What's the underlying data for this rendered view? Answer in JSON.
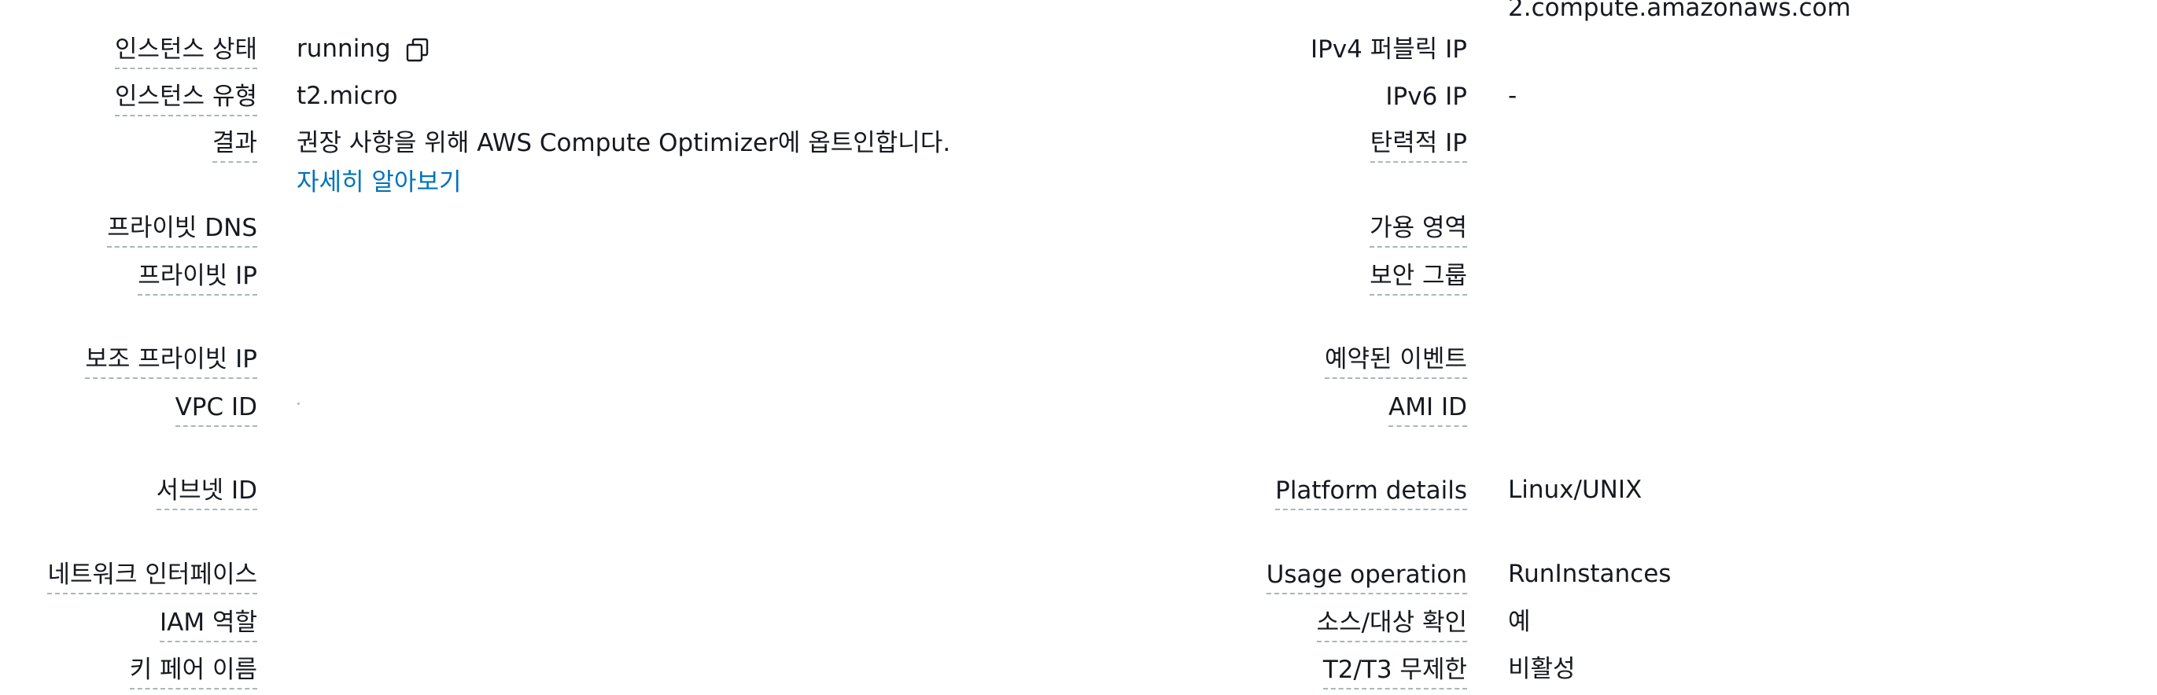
{
  "left": {
    "instance_state": {
      "label": "인스턴스 상태",
      "value": "running"
    },
    "instance_type": {
      "label": "인스턴스 유형",
      "value": "t2.micro"
    },
    "finding": {
      "label": "결과",
      "value": "권장 사항을 위해 AWS Compute Optimizer에 옵트인합니다.",
      "link": "자세히 알아보기"
    },
    "private_dns": {
      "label": "프라이빗 DNS"
    },
    "private_ip": {
      "label": "프라이빗 IP"
    },
    "secondary_private_ip": {
      "label": "보조 프라이빗 IP"
    },
    "vpc_id": {
      "label": "VPC ID"
    },
    "subnet_id": {
      "label": "서브넷 ID"
    },
    "network_interfaces": {
      "label": "네트워크 인터페이스"
    },
    "iam_role": {
      "label": "IAM 역할"
    },
    "key_pair": {
      "label": "키 페어 이름"
    }
  },
  "right": {
    "top_partial_value": "2.compute.amazonaws.com",
    "ipv4_public": {
      "label": "IPv4 퍼블릭 IP"
    },
    "ipv6": {
      "label": "IPv6 IP",
      "value": "-"
    },
    "elastic_ip": {
      "label": "탄력적 IP"
    },
    "availability_zone": {
      "label": "가용 영역"
    },
    "security_groups": {
      "label": "보안 그룹"
    },
    "scheduled_events": {
      "label": "예약된 이벤트"
    },
    "ami_id": {
      "label": "AMI ID"
    },
    "platform_details": {
      "label": "Platform details",
      "value": "Linux/UNIX"
    },
    "usage_operation": {
      "label": "Usage operation",
      "value": "RunInstances"
    },
    "source_dest_check": {
      "label": "소스/대상 확인",
      "value": "예"
    },
    "t2t3_unlimited": {
      "label": "T2/T3 무제한",
      "value": "비활성"
    }
  },
  "icons": {
    "copy": "copy-icon"
  },
  "colors": {
    "text": "#16191f",
    "link": "#0073bb",
    "dashed_underline": "#aab7b8"
  }
}
